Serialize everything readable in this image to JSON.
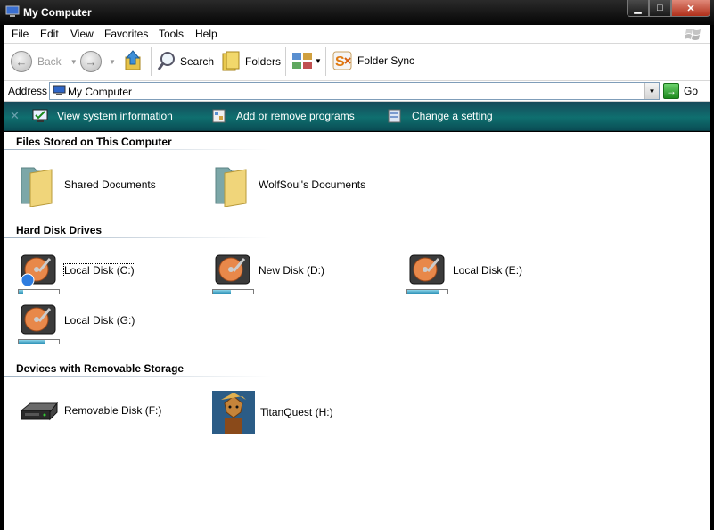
{
  "window": {
    "title": "My Computer"
  },
  "menu": [
    "File",
    "Edit",
    "View",
    "Favorites",
    "Tools",
    "Help"
  ],
  "toolbar": {
    "back": "Back",
    "search": "Search",
    "folders": "Folders",
    "folder_sync": "Folder Sync"
  },
  "address": {
    "label": "Address",
    "value": "My Computer",
    "go": "Go"
  },
  "tasks": [
    "View system information",
    "Add or remove programs",
    "Change a setting"
  ],
  "groups": {
    "files": "Files Stored on This Computer",
    "hdd": "Hard Disk Drives",
    "removable": "Devices with Removable Storage"
  },
  "files": [
    {
      "label": "Shared Documents"
    },
    {
      "label": "WolfSoul's Documents"
    }
  ],
  "drives": [
    {
      "label": "Local Disk (C:)",
      "used_fraction": 0.12
    },
    {
      "label": "New Disk (D:)",
      "used_fraction": 0.45
    },
    {
      "label": "Local Disk (E:)",
      "used_fraction": 0.8
    },
    {
      "label": "Local Disk (G:)",
      "used_fraction": 0.65
    }
  ],
  "removable": [
    {
      "label": "Removable Disk (F:)"
    },
    {
      "label": "TitanQuest (H:)"
    }
  ],
  "colors": {
    "task_bar": "#0f6f6f",
    "titlebar": "#0a0a0a",
    "drive_fill": "#2b8fb5"
  }
}
